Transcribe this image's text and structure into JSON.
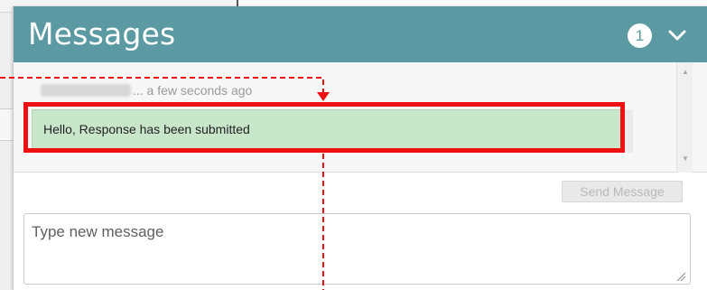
{
  "panel": {
    "title": "Messages",
    "unread_count": "1"
  },
  "messages": [
    {
      "meta_suffix": "... a few seconds ago",
      "text": "Hello, Response has been submitted"
    }
  ],
  "actions": {
    "send_label": "Send Message"
  },
  "compose": {
    "placeholder": "Type new message"
  },
  "colors": {
    "header": "#5b9aa3",
    "message_bubble": "#c8e6c9",
    "annotation": "#ee1111"
  },
  "icons": {
    "collapse": "chevron-down-icon",
    "resize": "resize-grip-icon"
  }
}
